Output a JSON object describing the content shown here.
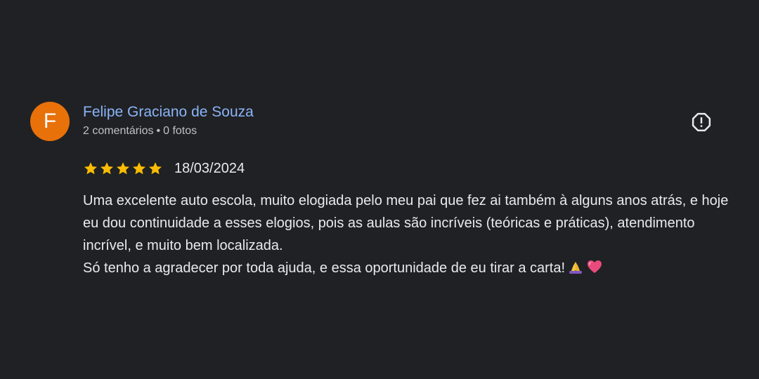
{
  "review": {
    "author": {
      "avatar_letter": "F",
      "avatar_color": "#e8710a",
      "name": "Felipe Graciano de Souza",
      "name_color": "#8ab4f8",
      "comments": "2 comentários",
      "separator": "•",
      "photos": "0 fotos"
    },
    "report_icon": "report-icon",
    "rating": 5,
    "max_rating": 5,
    "star_color": "#fbbc04",
    "date": "18/03/2024",
    "text_paragraph_1": "Uma excelente auto escola, muito elogiada pelo meu pai que fez ai também à alguns anos atrás, e hoje eu dou continuidade a esses elogios, pois as aulas são incríveis (teóricas e práticas), atendimento incrível, e muito bem localizada.",
    "text_paragraph_2": "Só tenho a agradecer por toda ajuda, e essa oportunidade de eu tirar a carta!",
    "emojis": [
      "folded-hands-icon",
      "heart-icon"
    ]
  }
}
